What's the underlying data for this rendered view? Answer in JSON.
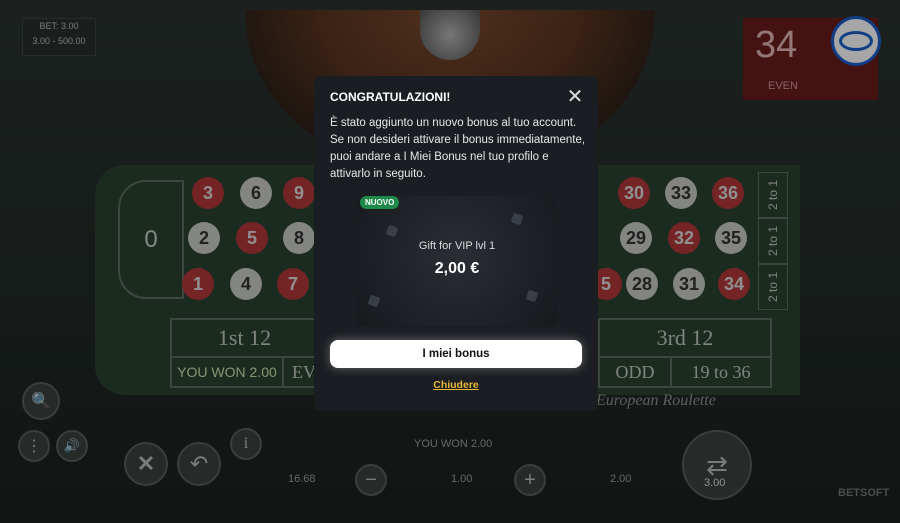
{
  "game": {
    "bet_label": "BET: 3.00",
    "bet_range": "3.00 - 500.00",
    "result_number": "34",
    "result_parity": "EVEN",
    "zero": "0",
    "numbers_row_top": [
      "3",
      "6",
      "9",
      "30",
      "33",
      "36"
    ],
    "numbers_row_mid": [
      "2",
      "5",
      "8",
      "29",
      "32",
      "35"
    ],
    "numbers_row_bot": [
      "1",
      "4",
      "7",
      "5",
      "28",
      "31",
      "34"
    ],
    "dozen_first": "1st 12",
    "dozen_third": "3rd 12",
    "you_won_label": "YOU WON 2.00",
    "ev_partial": "EV",
    "odd_label": "ODD",
    "high_label": "19 to 36",
    "two_to_one": "2 to 1",
    "table_name": "European Roulette",
    "status_text": "YOU WON 2.00",
    "balance": "16.68",
    "chip_value": "1.00",
    "total_bet": "2.00",
    "spin_bet": "3.00",
    "brand": "BETSOFT"
  },
  "modal": {
    "title": "CONGRATULAZIONI!",
    "message": "È stato aggiunto un nuovo bonus al tuo account. Se non desideri attivare il bonus immediatamente, puoi andare a I Miei Bonus nel tuo profilo e attivarlo in seguito.",
    "badge": "NUOVO",
    "bonus_name": "Gift for VIP lvl 1",
    "bonus_amount": "2,00 €",
    "primary_button": "I miei bonus",
    "close_link": "Chiudere"
  },
  "icons": {
    "close": "close-icon",
    "zoom": "zoom-icon",
    "menu": "more-icon",
    "sound": "sound-icon",
    "info": "info-icon",
    "clear": "clear-icon",
    "undo": "undo-icon",
    "spin": "spin-icon",
    "minus": "minus-icon",
    "plus": "plus-icon"
  }
}
